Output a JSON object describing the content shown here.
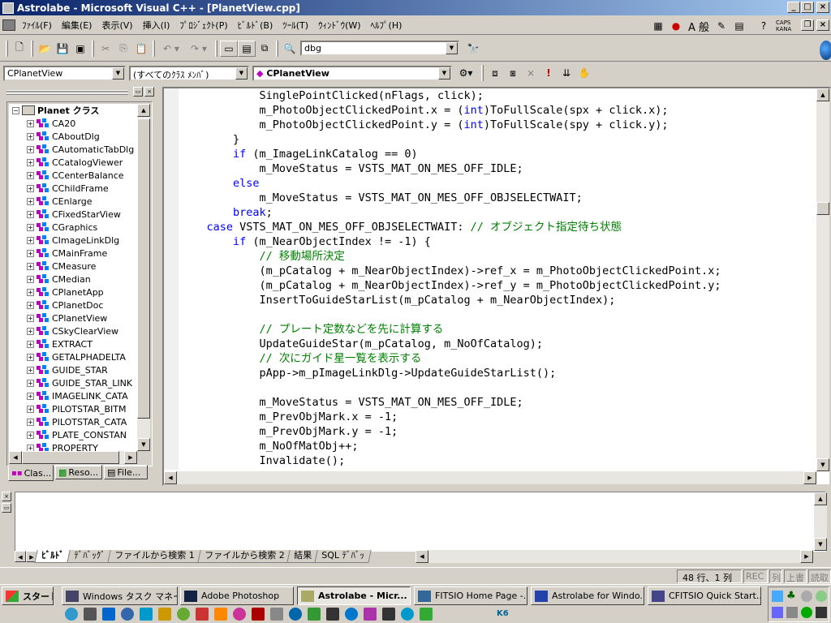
{
  "window": {
    "title": "Astrolabe - Microsoft Visual C++ - [PlanetView.cpp]"
  },
  "menu": [
    "ﾌｧｲﾙ(F)",
    "編集(E)",
    "表示(V)",
    "挿入(I)",
    "ﾌﾟﾛｼﾞｪｸﾄ(P)",
    "ﾋﾞﾙﾄﾞ(B)",
    "ﾂｰﾙ(T)",
    "ｳｨﾝﾄﾞｳ(W)",
    "ﾍﾙﾌﾟ(H)"
  ],
  "ime": {
    "kanji_label": "A 般",
    "caps": "CAPS",
    "kana": "KANA"
  },
  "toolbar": {
    "config_combo": "dbg"
  },
  "wizardbar": {
    "class_combo": "CPlanetView",
    "filter_combo": "(すべてのｸﾗｽ ﾒﾝﾊﾞ)",
    "member_combo": "CPlanetView"
  },
  "classview": {
    "root": "Planet クラス",
    "items": [
      "CA20",
      "CAboutDlg",
      "CAutomaticTabDlg",
      "CCatalogViewer",
      "CCenterBalance",
      "CChildFrame",
      "CEnlarge",
      "CFixedStarView",
      "CGraphics",
      "CImageLinkDlg",
      "CMainFrame",
      "CMeasure",
      "CMedian",
      "CPlanetApp",
      "CPlanetDoc",
      "CPlanetView",
      "CSkyClearView",
      "EXTRACT",
      "GETALPHADELTA",
      "GUIDE_STAR",
      "GUIDE_STAR_LINK",
      "IMAGELINK_CATA",
      "PILOTSTAR_BITM",
      "PILOTSTAR_CATA",
      "PLATE_CONSTAN",
      "PROPERTY"
    ],
    "tabs": [
      "Clas...",
      "Reso...",
      "File..."
    ]
  },
  "code_lines": [
    [
      {
        "t": "            SinglePointClicked(nFlags, click);"
      }
    ],
    [
      {
        "t": "            m_PhotoObjectClickedPoint.x = ("
      },
      {
        "t": "int",
        "c": "kw"
      },
      {
        "t": ")ToFullScale(spx + click.x);"
      }
    ],
    [
      {
        "t": "            m_PhotoObjectClickedPoint.y = ("
      },
      {
        "t": "int",
        "c": "kw"
      },
      {
        "t": ")ToFullScale(spy + click.y);"
      }
    ],
    [
      {
        "t": "        }"
      }
    ],
    [
      {
        "t": "        "
      },
      {
        "t": "if",
        "c": "kw"
      },
      {
        "t": " (m_ImageLinkCatalog == 0)"
      }
    ],
    [
      {
        "t": "            m_MoveStatus = VSTS_MAT_ON_MES_OFF_IDLE;"
      }
    ],
    [
      {
        "t": "        "
      },
      {
        "t": "else",
        "c": "kw"
      }
    ],
    [
      {
        "t": "            m_MoveStatus = VSTS_MAT_ON_MES_OFF_OBJSELECTWAIT;"
      }
    ],
    [
      {
        "t": "        "
      },
      {
        "t": "break",
        "c": "kw"
      },
      {
        "t": ";"
      }
    ],
    [
      {
        "t": "    "
      },
      {
        "t": "case",
        "c": "kw"
      },
      {
        "t": " VSTS_MAT_ON_MES_OFF_OBJSELECTWAIT: "
      },
      {
        "t": "// オブジェクト指定待ち状態",
        "c": "cm"
      }
    ],
    [
      {
        "t": "        "
      },
      {
        "t": "if",
        "c": "kw"
      },
      {
        "t": " (m_NearObjectIndex != -1) {"
      }
    ],
    [
      {
        "t": "            "
      },
      {
        "t": "// 移動場所決定",
        "c": "cm"
      }
    ],
    [
      {
        "t": "            (m_pCatalog + m_NearObjectIndex)->ref_x = m_PhotoObjectClickedPoint.x;"
      }
    ],
    [
      {
        "t": "            (m_pCatalog + m_NearObjectIndex)->ref_y = m_PhotoObjectClickedPoint.y;"
      }
    ],
    [
      {
        "t": "            InsertToGuideStarList(m_pCatalog + m_NearObjectIndex);"
      }
    ],
    [
      {
        "t": ""
      }
    ],
    [
      {
        "t": "            "
      },
      {
        "t": "// プレート定数などを先に計算する",
        "c": "cm"
      }
    ],
    [
      {
        "t": "            UpdateGuideStar(m_pCatalog, m_NoOfCatalog);"
      }
    ],
    [
      {
        "t": "            "
      },
      {
        "t": "// 次にガイド星一覧を表示する",
        "c": "cm"
      }
    ],
    [
      {
        "t": "            pApp->m_pImageLinkDlg->UpdateGuideStarList();"
      }
    ],
    [
      {
        "t": ""
      }
    ],
    [
      {
        "t": "            m_MoveStatus = VSTS_MAT_ON_MES_OFF_IDLE;"
      }
    ],
    [
      {
        "t": "            m_PrevObjMark.x = -1;"
      }
    ],
    [
      {
        "t": "            m_PrevObjMark.y = -1;"
      }
    ],
    [
      {
        "t": "            m_NoOfMatObj++;"
      }
    ],
    [
      {
        "t": "            Invalidate();"
      }
    ],
    [
      {
        "t": "        }"
      }
    ]
  ],
  "output_tabs": [
    "ﾋﾞﾙﾄﾞ",
    "ﾃﾞﾊﾞｯｸﾞ",
    "ファイルから検索 1",
    "ファイルから検索 2",
    "結果",
    "SQL ﾃﾞﾊﾞｯ"
  ],
  "status": {
    "position": "48 行、1 列",
    "rec": "REC",
    "col": "列",
    "ovr": "上書",
    "read": "読取"
  },
  "taskbar": {
    "start": "スタート",
    "tasks": [
      "Windows タスク マネー...",
      "Adobe Photoshop",
      "Astrolabe - Micr...",
      "FITSIO Home Page -...",
      "Astrolabe for Windo...",
      "CFITSIO Quick Start..."
    ],
    "quicklaunch_text": "K6"
  },
  "colors": {
    "keyword": "#0000ff",
    "comment": "#008000",
    "titlebar": "#0a246a"
  }
}
